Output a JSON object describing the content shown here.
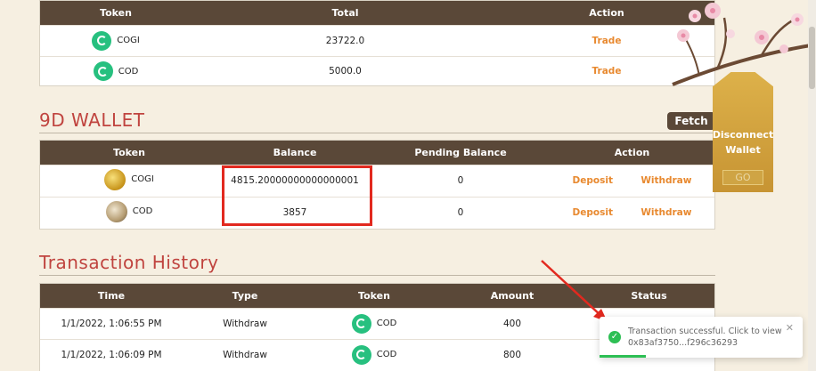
{
  "tokens_table": {
    "headers": [
      "Token",
      "Total",
      "Action"
    ],
    "rows": [
      {
        "token": "COGI",
        "total": "23722.0",
        "action": "Trade"
      },
      {
        "token": "COD",
        "total": "5000.0",
        "action": "Trade"
      }
    ]
  },
  "wallet": {
    "title": "9D WALLET",
    "fetch_label": "Fetch",
    "headers": [
      "Token",
      "Balance",
      "Pending Balance",
      "Action"
    ],
    "rows": [
      {
        "token": "COGI",
        "balance": "4815.20000000000000001",
        "pending": "0",
        "deposit": "Deposit",
        "withdraw": "Withdraw"
      },
      {
        "token": "COD",
        "balance": "3857",
        "pending": "0",
        "deposit": "Deposit",
        "withdraw": "Withdraw"
      }
    ]
  },
  "history": {
    "title": "Transaction History",
    "headers": [
      "Time",
      "Type",
      "Token",
      "Amount",
      "Status"
    ],
    "rows": [
      {
        "time": "1/1/2022, 1:06:55 PM",
        "type": "Withdraw",
        "token": "COD",
        "amount": "400"
      },
      {
        "time": "1/1/2022, 1:06:09 PM",
        "type": "Withdraw",
        "token": "COD",
        "amount": "800"
      }
    ]
  },
  "wallet_tag": {
    "line1": "Disconnect",
    "line2": "Wallet",
    "go": "GO"
  },
  "toast": {
    "line1": "Transaction successful. Click to view",
    "line2": "0x83af3750...f296c36293",
    "close": "✕",
    "progress_fraction": 0.23
  },
  "colors": {
    "header_bg": "#5a4838",
    "accent_red": "#c0443f",
    "action_orange": "#e8892f",
    "success_green": "#2dbf54",
    "highlight_red": "#e2291f"
  }
}
